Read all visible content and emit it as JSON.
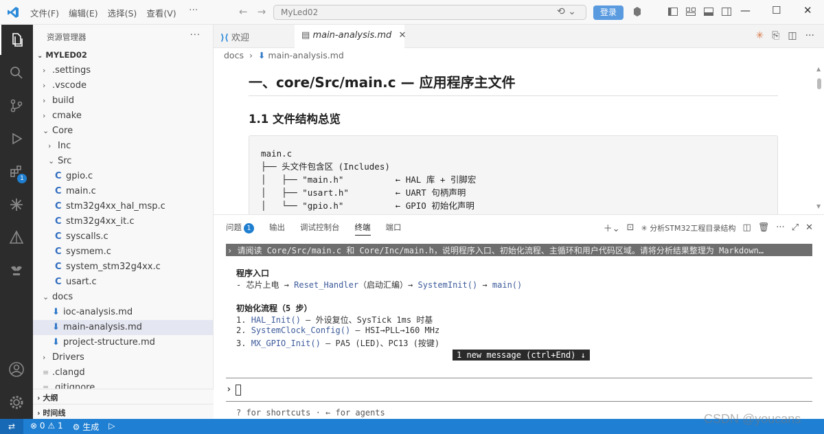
{
  "titlebar": {
    "menus": [
      "文件(F)",
      "编辑(E)",
      "选择(S)",
      "查看(V)"
    ],
    "more": "···",
    "search_value": "MyLed02",
    "login_label": "登录",
    "window_controls": [
      "—",
      "☐",
      "✕"
    ]
  },
  "activity": {
    "extensions_badge": "1"
  },
  "sidebar": {
    "title": "资源管理器",
    "more": "···",
    "root": "MYLED02",
    "items": [
      {
        "label": ".settings",
        "depth": 0,
        "kind": "folder-closed"
      },
      {
        "label": ".vscode",
        "depth": 0,
        "kind": "folder-closed"
      },
      {
        "label": "build",
        "depth": 0,
        "kind": "folder-closed"
      },
      {
        "label": "cmake",
        "depth": 0,
        "kind": "folder-closed"
      },
      {
        "label": "Core",
        "depth": 0,
        "kind": "folder-open"
      },
      {
        "label": "Inc",
        "depth": 1,
        "kind": "folder-closed"
      },
      {
        "label": "Src",
        "depth": 1,
        "kind": "folder-open"
      },
      {
        "label": "gpio.c",
        "depth": 2,
        "kind": "c"
      },
      {
        "label": "main.c",
        "depth": 2,
        "kind": "c"
      },
      {
        "label": "stm32g4xx_hal_msp.c",
        "depth": 2,
        "kind": "c"
      },
      {
        "label": "stm32g4xx_it.c",
        "depth": 2,
        "kind": "c"
      },
      {
        "label": "syscalls.c",
        "depth": 2,
        "kind": "c"
      },
      {
        "label": "sysmem.c",
        "depth": 2,
        "kind": "c"
      },
      {
        "label": "system_stm32g4xx.c",
        "depth": 2,
        "kind": "c"
      },
      {
        "label": "usart.c",
        "depth": 2,
        "kind": "c"
      },
      {
        "label": "docs",
        "depth": 0,
        "kind": "folder-open"
      },
      {
        "label": "ioc-analysis.md",
        "depth": 1,
        "kind": "md"
      },
      {
        "label": "main-analysis.md",
        "depth": 1,
        "kind": "md",
        "selected": true
      },
      {
        "label": "project-structure.md",
        "depth": 1,
        "kind": "md"
      },
      {
        "label": "Drivers",
        "depth": 0,
        "kind": "folder-closed"
      },
      {
        "label": ".clangd",
        "depth": 0,
        "kind": "file"
      },
      {
        "label": ".gitignore",
        "depth": 0,
        "kind": "file"
      }
    ],
    "outline_label": "大纲",
    "timeline_label": "时间线"
  },
  "tabs": [
    {
      "label": "欢迎",
      "active": false
    },
    {
      "label": "main-analysis.md",
      "active": true,
      "close": "✕"
    }
  ],
  "breadcrumb": {
    "folder": "docs",
    "sep": "›",
    "file": "main-analysis.md"
  },
  "editor": {
    "h1": "一、core/Src/main.c — 应用程序主文件",
    "h2": "1.1 文件结构总览",
    "code_lines": [
      "main.c",
      "├── 头文件包含区 (Includes)",
      "│   ├── \"main.h\"          ← HAL 库 + 引脚宏",
      "│   ├── \"usart.h\"         ← UART 句柄声明",
      "│   └── \"gpio.h\"          ← GPIO 初始化声明"
    ]
  },
  "panel": {
    "tabs": [
      {
        "label": "问题",
        "badge": "1"
      },
      {
        "label": "输出"
      },
      {
        "label": "调试控制台"
      },
      {
        "label": "终端",
        "active": true
      },
      {
        "label": "端口"
      }
    ],
    "terminal_name": "✳ 分析STM32工程目录结构",
    "prompt": "› 请阅读 Core/Src/main.c 和 Core/Inc/main.h，说明程序入口、初始化流程、主循环和用户代码区域。请将分析结果整理为 Markdown…",
    "section1_title": "程序入口",
    "section1_line_prefix": "- 芯片上电 → ",
    "section1_fn1": "Reset_Handler",
    "section1_mid": "（启动汇编）→ ",
    "section1_fn2": "SystemInit()",
    "section1_arrow": " → ",
    "section1_fn3": "main()",
    "section2_title": "初始化流程（5 步）",
    "steps": [
      {
        "num": "1. ",
        "fn": "HAL_Init()",
        "desc": " — 外设复位、SysTick 1ms 时基"
      },
      {
        "num": "2. ",
        "fn": "SystemClock_Config()",
        "desc": " — HSI→PLL→160 MHz"
      },
      {
        "num": "3. ",
        "fn": "MX_GPIO_Init()",
        "desc": " — PA5 (LED)、PC13 (按键)"
      }
    ],
    "new_message": "1 new message (ctrl+End) ↓",
    "input_prompt": "›",
    "hint": "? for shortcuts · ← for agents"
  },
  "statusbar": {
    "errors": "0",
    "warnings": "1",
    "build_label": "生成"
  },
  "watermark": "CSDN @youcans"
}
